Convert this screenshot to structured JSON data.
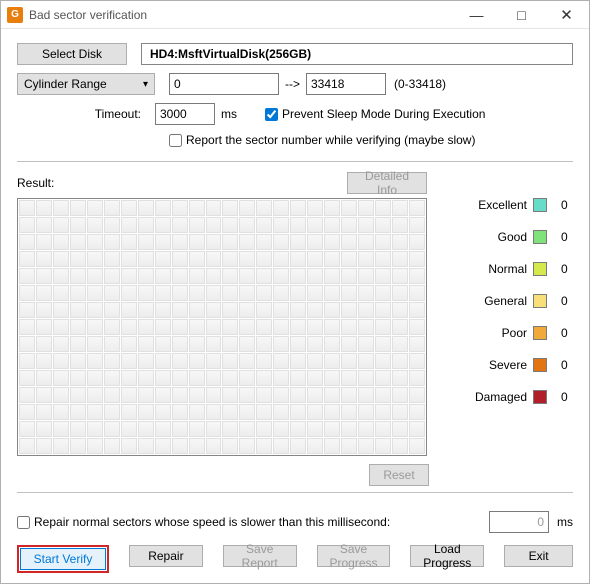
{
  "window": {
    "title": "Bad sector verification",
    "app_icon_letter": "G"
  },
  "top": {
    "select_disk_label": "Select Disk",
    "disk_name": "HD4:MsftVirtualDisk(256GB)",
    "range_mode": "Cylinder Range",
    "range_start": "0",
    "range_end": "33418",
    "range_hint": "(0-33418)",
    "timeout_label": "Timeout:",
    "timeout_value": "3000",
    "timeout_unit": "ms",
    "prevent_sleep_label": "Prevent Sleep Mode During Execution",
    "prevent_sleep_checked": true,
    "report_sector_label": "Report the sector number while verifying (maybe slow)",
    "report_sector_checked": false
  },
  "result": {
    "label": "Result:",
    "detailed_info_label": "Detailed Info",
    "reset_label": "Reset",
    "legend": [
      {
        "name": "Excellent",
        "color": "#66dcc9",
        "count": 0
      },
      {
        "name": "Good",
        "color": "#7fe27a",
        "count": 0
      },
      {
        "name": "Normal",
        "color": "#d5e84e",
        "count": 0
      },
      {
        "name": "General",
        "color": "#f7e07a",
        "count": 0
      },
      {
        "name": "Poor",
        "color": "#f0a93a",
        "count": 0
      },
      {
        "name": "Severe",
        "color": "#e07512",
        "count": 0
      },
      {
        "name": "Damaged",
        "color": "#b1202a",
        "count": 0
      }
    ]
  },
  "bottom": {
    "repair_opt_label": "Repair normal sectors whose speed is slower than this millisecond:",
    "repair_opt_checked": false,
    "repair_opt_value": "0",
    "repair_opt_unit": "ms",
    "start_verify_label": "Start Verify",
    "repair_label": "Repair",
    "save_report_label": "Save Report",
    "save_progress_label": "Save Progress",
    "load_progress_label": "Load Progress",
    "exit_label": "Exit"
  }
}
